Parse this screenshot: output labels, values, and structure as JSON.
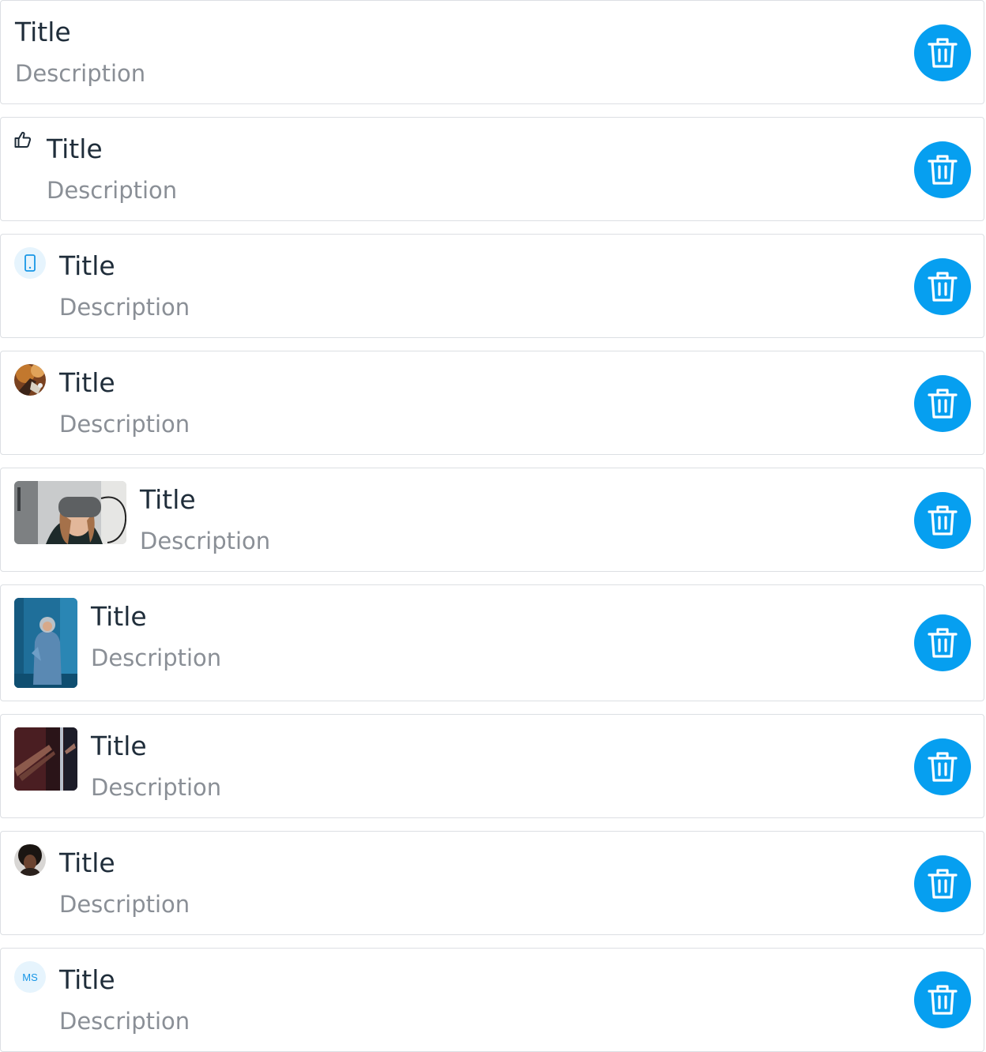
{
  "colors": {
    "accent": "#069ff0",
    "title": "#1f2d3a",
    "description": "#8a8f96",
    "border": "#dcdfe3"
  },
  "items": [
    {
      "title": "Title",
      "description": "Description",
      "media": "none",
      "delete_icon": "trash-icon"
    },
    {
      "title": "Title",
      "description": "Description",
      "media": "thumbs-up-icon",
      "delete_icon": "trash-icon"
    },
    {
      "title": "Title",
      "description": "Description",
      "media": "phone-icon",
      "delete_icon": "trash-icon"
    },
    {
      "title": "Title",
      "description": "Description",
      "media": "avatar-photo",
      "delete_icon": "trash-icon"
    },
    {
      "title": "Title",
      "description": "Description",
      "media": "wide-thumbnail-photo",
      "delete_icon": "trash-icon"
    },
    {
      "title": "Title",
      "description": "Description",
      "media": "tall-thumbnail-photo",
      "delete_icon": "trash-icon"
    },
    {
      "title": "Title",
      "description": "Description",
      "media": "square-thumbnail-photo",
      "delete_icon": "trash-icon"
    },
    {
      "title": "Title",
      "description": "Description",
      "media": "avatar-photo",
      "delete_icon": "trash-icon"
    },
    {
      "title": "Title",
      "description": "Description",
      "media": "initials-avatar",
      "initials": "MS",
      "delete_icon": "trash-icon"
    }
  ]
}
